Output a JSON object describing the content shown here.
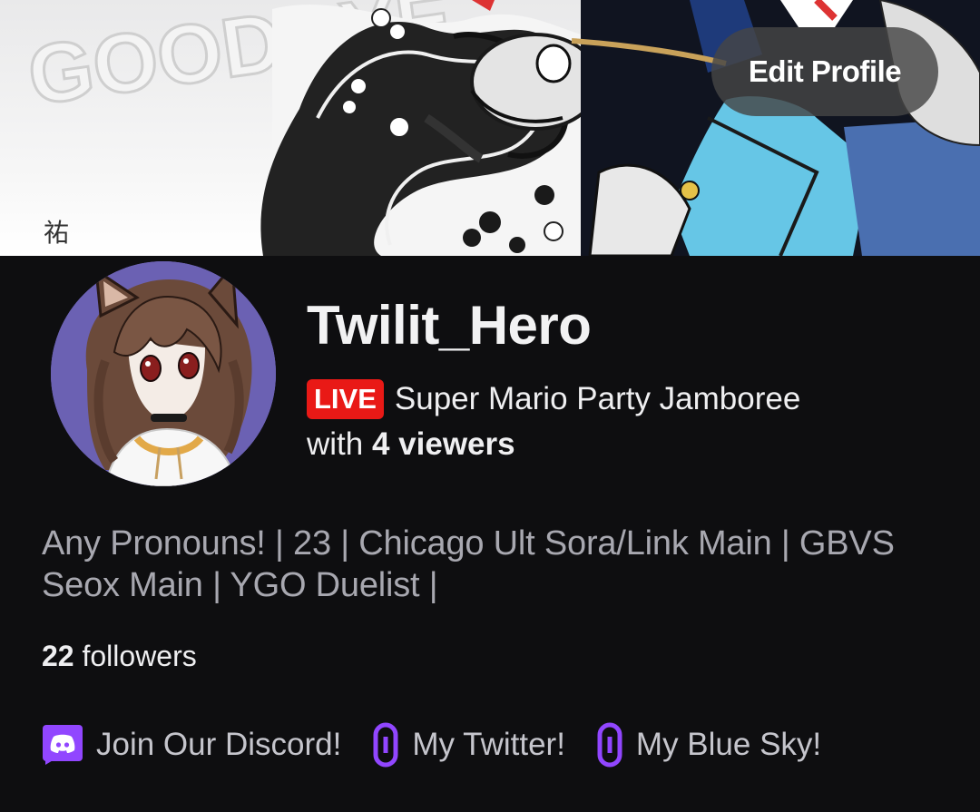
{
  "header": {
    "edit_profile_label": "Edit Profile"
  },
  "channel": {
    "display_name": "Twilit_Hero",
    "live_badge": "LIVE",
    "game": "Super Mario Party Jamboree",
    "viewers_prefix": "with",
    "viewers_count": "4 viewers",
    "bio": "Any Pronouns! | 23 | Chicago Ult Sora/Link Main | GBVS Seox Main | YGO Duelist |",
    "followers_count": "22",
    "followers_label": "followers"
  },
  "links": [
    {
      "label": "Join Our Discord!",
      "icon": "discord-icon"
    },
    {
      "label": "My Twitter!",
      "icon": "link-icon"
    },
    {
      "label": "My Blue Sky!",
      "icon": "link-icon"
    }
  ],
  "colors": {
    "background": "#0e0e10",
    "live_red": "#e91916",
    "accent_purple": "#9146ff",
    "bio_gray": "#a8a8b0"
  }
}
